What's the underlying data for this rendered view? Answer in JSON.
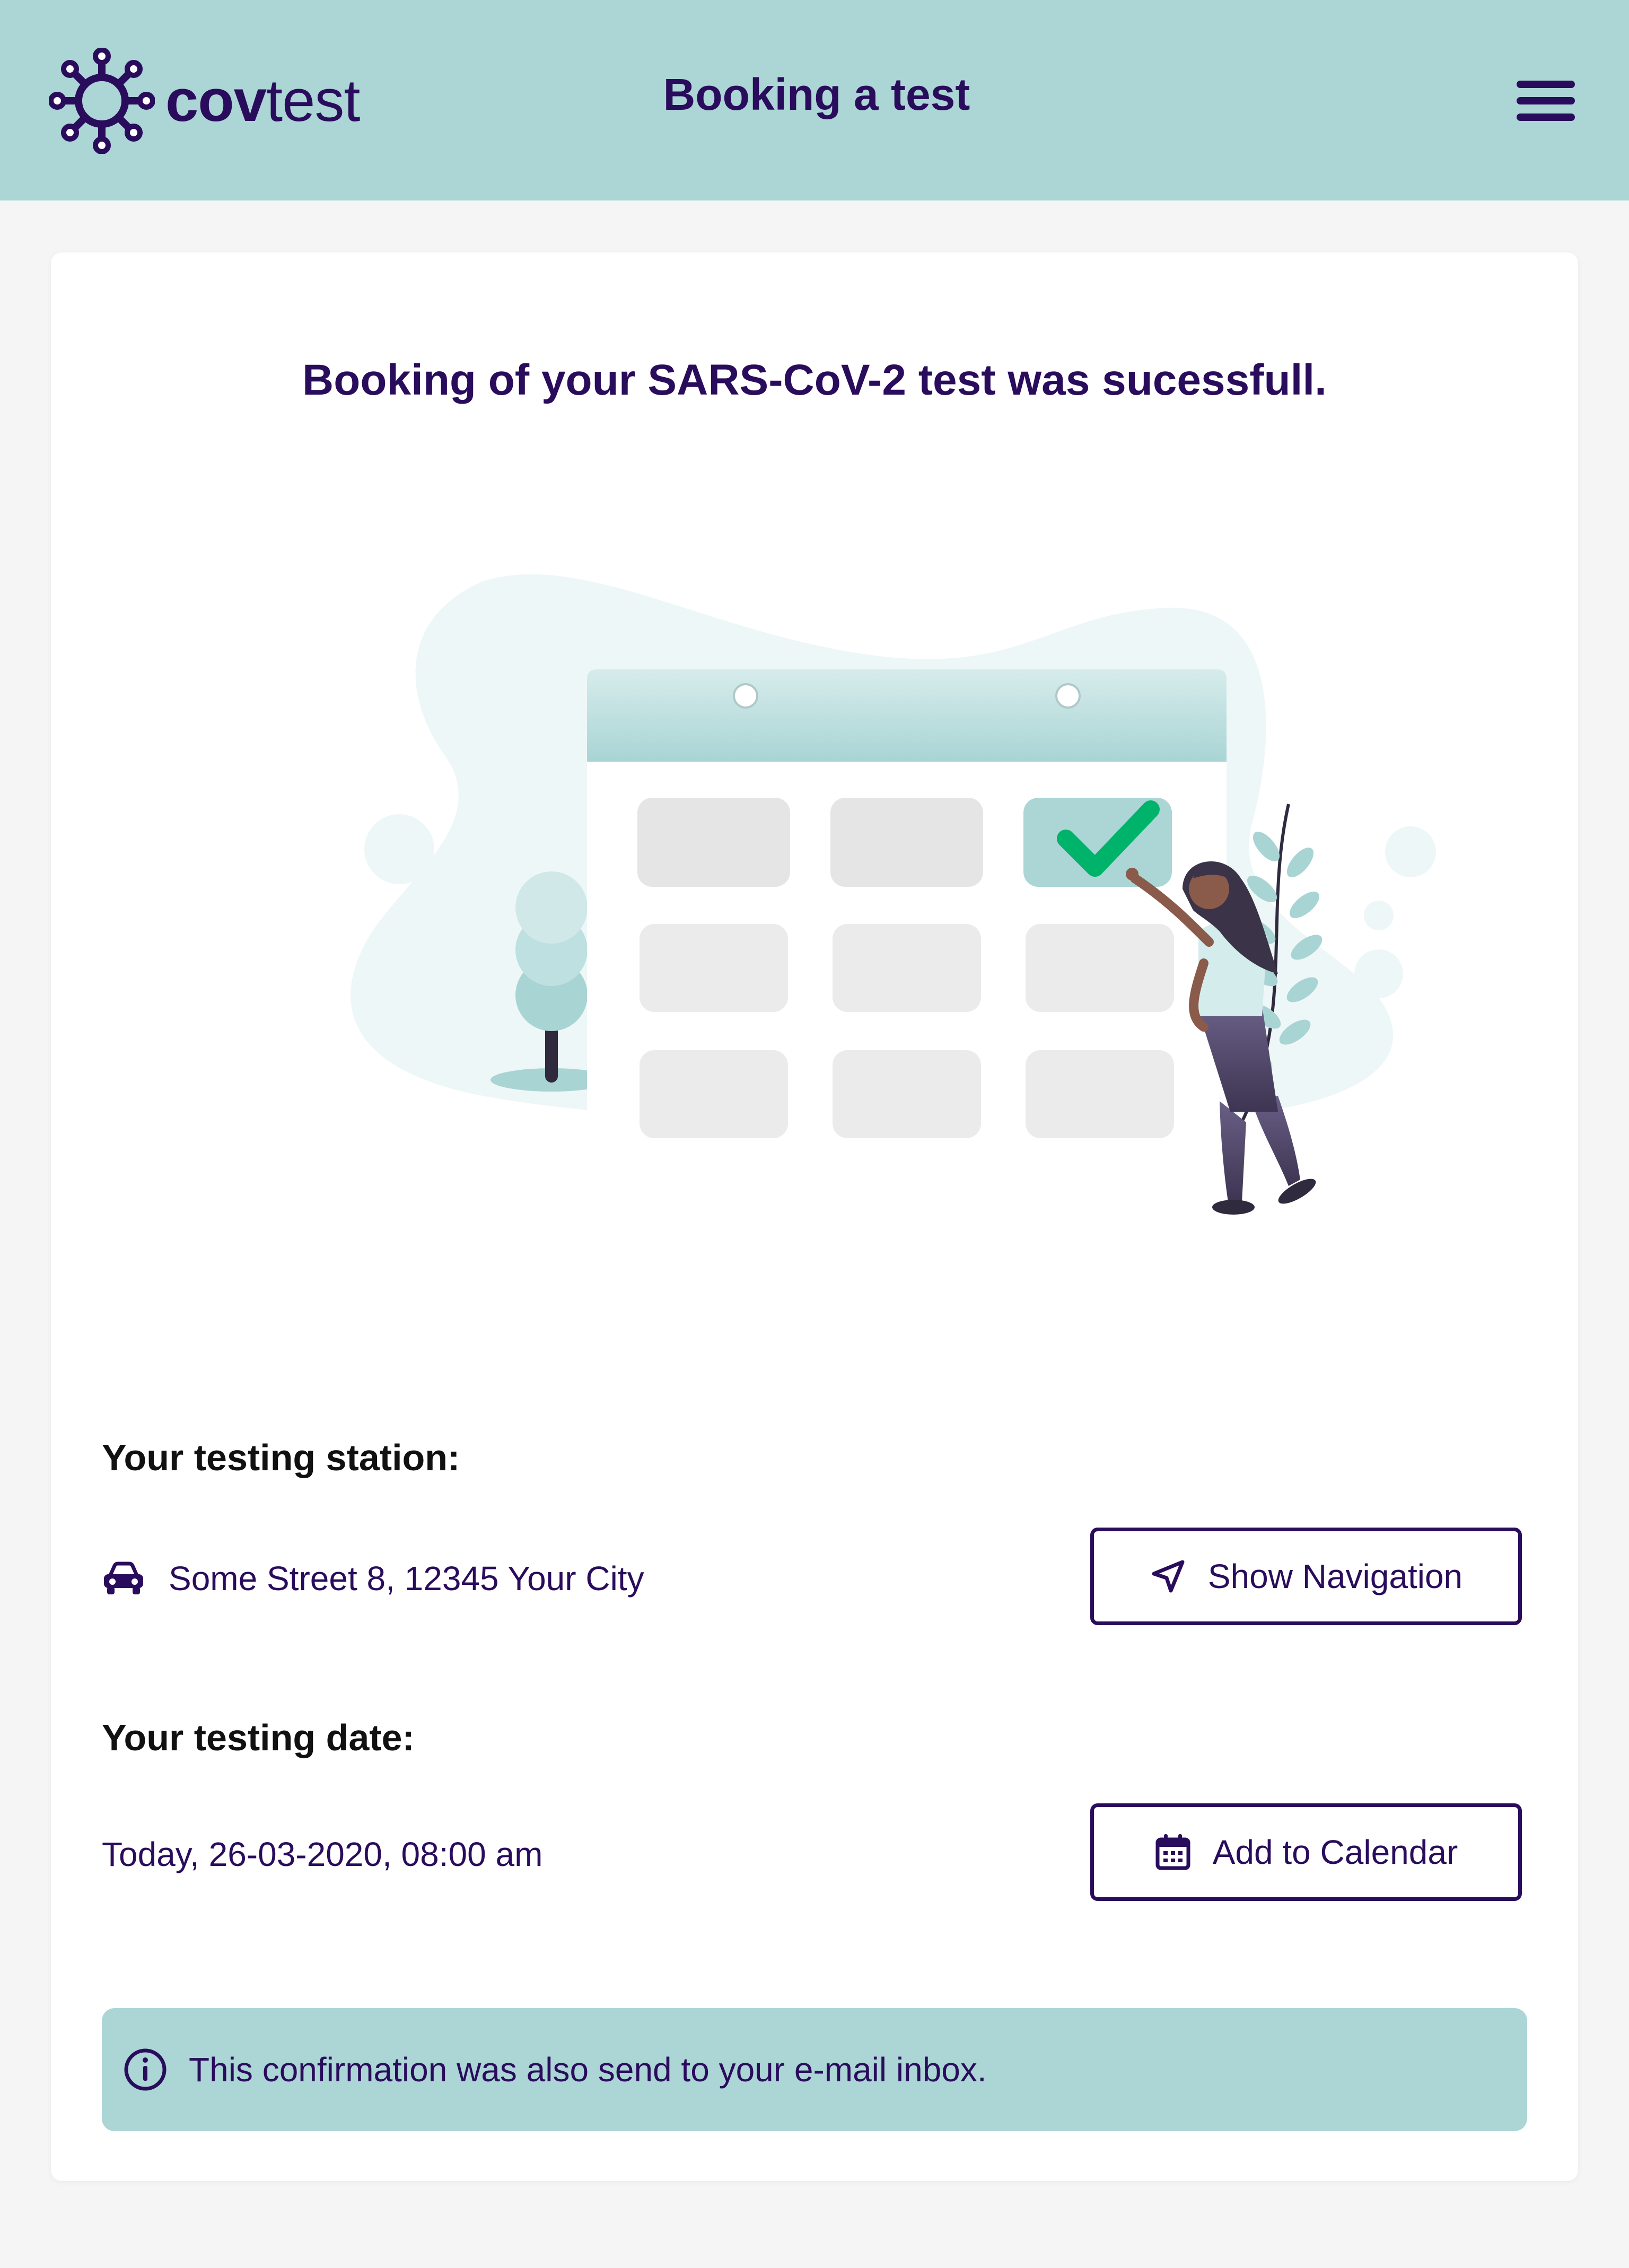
{
  "header": {
    "logo_bold": "cov",
    "logo_light": "test",
    "title": "Booking a test",
    "menu_icon": "hamburger-menu-icon"
  },
  "main": {
    "headline": "Booking of your SARS-CoV-2 test was sucessfull.",
    "station": {
      "label": "Your testing station:",
      "address": "Some Street 8, 12345 Your City",
      "icon": "car-icon",
      "button_label": "Show Navigation",
      "button_icon": "navigation-arrow-icon"
    },
    "date": {
      "label": "Your testing date:",
      "value": "Today, 26-03-2020, 08:00 am",
      "button_label": "Add to Calendar",
      "button_icon": "calendar-icon"
    },
    "info": {
      "icon": "info-icon",
      "text": "This confirmation was also send to your e-mail inbox."
    }
  },
  "colors": {
    "header_bg": "#acd5d6",
    "primary_text": "#2a0c5c",
    "page_bg": "#f5f5f5",
    "check_green": "#00b36b"
  }
}
